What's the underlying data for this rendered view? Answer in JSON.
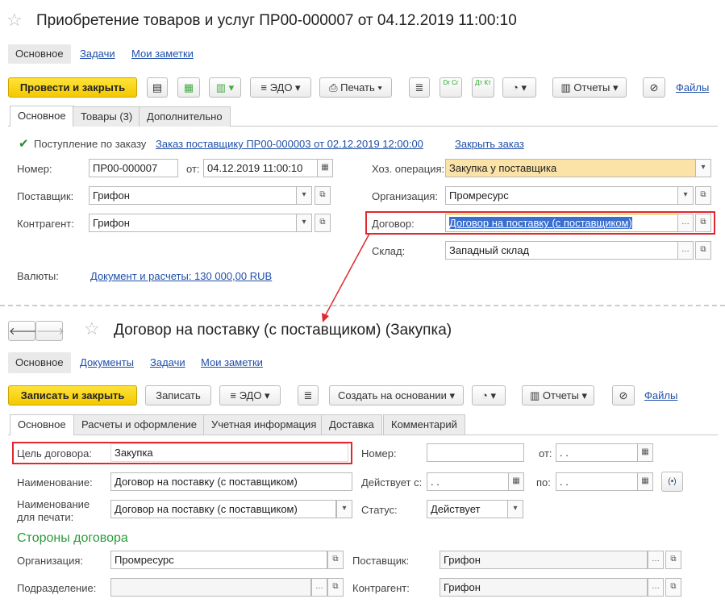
{
  "doc1": {
    "title": "Приобретение товаров и услуг ПР00-000007 от 04.12.2019 11:00:10",
    "nav": [
      "Основное",
      "Задачи",
      "Мои заметки"
    ],
    "toolbar": {
      "post_close": "Провести и закрыть",
      "edo": "ЭДО",
      "print": "Печать",
      "reports": "Отчеты",
      "files": "Файлы",
      "dtkt": "Дт Кт",
      "drcr": "Dr Cr"
    },
    "tabs": [
      "Основное",
      "Товары (3)",
      "Дополнительно"
    ],
    "by_order_label": "Поступление по заказу",
    "order_link": "Заказ поставщику ПР00-000003 от 02.12.2019 12:00:00",
    "close_order": "Закрыть заказ",
    "number_label": "Номер:",
    "number": "ПР00-000007",
    "from_label": "от:",
    "date": "04.12.2019 11:00:10",
    "supplier_label": "Поставщик:",
    "supplier": "Грифон",
    "counterparty_label": "Контрагент:",
    "counterparty": "Грифон",
    "currency_label": "Валюты:",
    "currency_link": "Документ и расчеты: 130 000,00 RUB",
    "operation_label": "Хоз. операция:",
    "operation": "Закупка у поставщика",
    "org_label": "Организация:",
    "org": "Промресурс",
    "contract_label": "Договор:",
    "contract": "Договор на поставку (с поставщиком)",
    "warehouse_label": "Склад:",
    "warehouse": "Западный склад"
  },
  "doc2": {
    "title": "Договор на поставку (с поставщиком) (Закупка)",
    "nav": [
      "Основное",
      "Документы",
      "Задачи",
      "Мои заметки"
    ],
    "toolbar": {
      "save_close": "Записать и закрыть",
      "save": "Записать",
      "edo": "ЭДО",
      "create_based": "Создать на основании",
      "reports": "Отчеты",
      "files": "Файлы"
    },
    "tabs": [
      "Основное",
      "Расчеты и оформление",
      "Учетная информация",
      "Доставка",
      "Комментарий"
    ],
    "purpose_label": "Цель договора:",
    "purpose": "Закупка",
    "number_label": "Номер:",
    "from_label": "от:",
    "empty_date": " .  .",
    "name_label": "Наименование:",
    "name": "Договор на поставку (с поставщиком)",
    "valid_from_label": "Действует с:",
    "to_label": "по:",
    "print_name_label": "Наименование\nдля печати:",
    "print_name": "Договор на поставку (с поставщиком)",
    "status_label": "Статус:",
    "status": "Действует",
    "parties_header": "Стороны договора",
    "org_label": "Организация:",
    "org": "Промресурс",
    "supplier_label": "Поставщик:",
    "supplier": "Грифон",
    "division_label": "Подразделение:",
    "counterparty_label": "Контрагент:",
    "counterparty": "Грифон"
  }
}
